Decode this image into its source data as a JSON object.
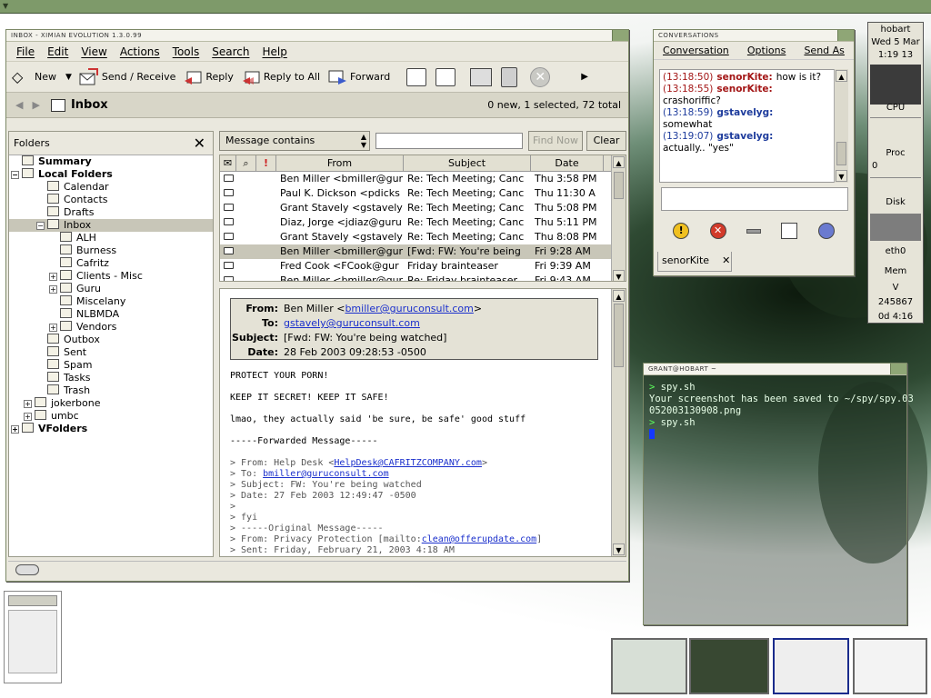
{
  "evolution": {
    "window_title": "INBOX - XIMIAN EVOLUTION 1.3.0.99",
    "menu": [
      "File",
      "Edit",
      "View",
      "Actions",
      "Tools",
      "Search",
      "Help"
    ],
    "toolbar": {
      "new": "New",
      "send_receive": "Send / Receive",
      "reply": "Reply",
      "reply_all": "Reply to All",
      "forward": "Forward"
    },
    "folder_title": "Inbox",
    "folder_count": "0 new, 1 selected, 72 total",
    "folders_header": "Folders",
    "folders": [
      {
        "label": "Summary",
        "depth": 0,
        "bold": true
      },
      {
        "label": "Local Folders",
        "depth": 0,
        "bold": true,
        "expander": "−"
      },
      {
        "label": "Calendar",
        "depth": 2
      },
      {
        "label": "Contacts",
        "depth": 2
      },
      {
        "label": "Drafts",
        "depth": 2
      },
      {
        "label": "Inbox",
        "depth": 2,
        "selected": true,
        "expander": "−"
      },
      {
        "label": "ALH",
        "depth": 3
      },
      {
        "label": "Burness",
        "depth": 3
      },
      {
        "label": "Cafritz",
        "depth": 3
      },
      {
        "label": "Clients - Misc",
        "depth": 3,
        "expander": "+"
      },
      {
        "label": "Guru",
        "depth": 3,
        "expander": "+"
      },
      {
        "label": "Miscelany",
        "depth": 3
      },
      {
        "label": "NLBMDA",
        "depth": 3
      },
      {
        "label": "Vendors",
        "depth": 3,
        "expander": "+"
      },
      {
        "label": "Outbox",
        "depth": 2
      },
      {
        "label": "Sent",
        "depth": 2
      },
      {
        "label": "Spam",
        "depth": 2
      },
      {
        "label": "Tasks",
        "depth": 2
      },
      {
        "label": "Trash",
        "depth": 2
      },
      {
        "label": "jokerbone",
        "depth": 1,
        "expander": "+"
      },
      {
        "label": "umbc",
        "depth": 1,
        "expander": "+"
      },
      {
        "label": "VFolders",
        "depth": 0,
        "bold": true,
        "expander": "+"
      }
    ],
    "search": {
      "option": "Message contains",
      "find_now": "Find Now",
      "clear": "Clear"
    },
    "columns": {
      "flag": "!",
      "from": "From",
      "subject": "Subject",
      "date": "Date"
    },
    "messages": [
      {
        "from": "Ben Miller <bmiller@gur",
        "subject": "Re: Tech Meeting; Canc",
        "date": "Thu 3:58 PM"
      },
      {
        "from": "Paul K. Dickson <pdicks",
        "subject": "Re: Tech Meeting; Canc",
        "date": "Thu 11:30 A"
      },
      {
        "from": "Grant Stavely <gstavely",
        "subject": "Re: Tech Meeting; Canc",
        "date": "Thu 5:08 PM"
      },
      {
        "from": "Diaz, Jorge <jdiaz@guru",
        "subject": "Re: Tech Meeting; Canc",
        "date": "Thu 5:11 PM"
      },
      {
        "from": "Grant Stavely <gstavely",
        "subject": "Re: Tech Meeting; Canc",
        "date": "Thu 8:08 PM"
      },
      {
        "from": "Ben Miller <bmiller@gur",
        "subject": "[Fwd: FW: You're being",
        "date": "Fri 9:28 AM",
        "selected": true
      },
      {
        "from": "Fred Cook <FCook@gur",
        "subject": "Friday brainteaser",
        "date": "Fri 9:39 AM"
      },
      {
        "from": "Ben Miller <bmiller@gur",
        "subject": "Re: Friday brainteaser",
        "date": "Fri 9:43 AM"
      }
    ],
    "preview": {
      "from_label": "From:",
      "from_name": "Ben Miller <",
      "from_email": "bmiller@guruconsult.com",
      "from_end": ">",
      "to_label": "To:",
      "to": "gstavely@guruconsult.com",
      "subject_label": "Subject:",
      "subject": "[Fwd: FW: You're being watched]",
      "date_label": "Date:",
      "date": "28 Feb 2003 09:28:53 -0500",
      "body_1": "PROTECT YOUR PORN!",
      "body_2": "KEEP IT SECRET! KEEP IT SAFE!",
      "body_3": "lmao, they actually said 'be sure, be safe' good stuff",
      "body_4": "-----Forwarded Message-----",
      "q1_pre": "> From: Help Desk <",
      "q1_link": "HelpDesk@CAFRITZCOMPANY.com",
      "q1_post": ">",
      "q2_pre": "> To: ",
      "q2_link": "bmiller@guruconsult.com",
      "q3": "> Subject: FW: You're being watched",
      "q4": "> Date: 27 Feb 2003 12:49:47 -0500",
      "q5": ">",
      "q6": "> fyi",
      "q7": "> -----Original Message-----",
      "q8_pre": "> From: Privacy Protection [mailto:",
      "q8_link": "clean@offerupdate.com",
      "q8_post": "]",
      "q9": "> Sent: Friday, February 21, 2003 4:18 AM"
    }
  },
  "conversations": {
    "window_title": "CONVERSATIONS",
    "menu": [
      "Conversation",
      "Options",
      "Send As"
    ],
    "log": [
      {
        "time": "(13:18:50)",
        "nick": "senorKite:",
        "text": "how is it?",
        "self": false,
        "inline": true
      },
      {
        "time": "(13:18:55)",
        "nick": "senorKite:",
        "text": "crashoriffic?",
        "self": false,
        "inline": false
      },
      {
        "time": "(13:18:59)",
        "nick": "gstavelyg:",
        "text": "somewhat",
        "self": true,
        "inline": false
      },
      {
        "time": "(13:19:07)",
        "nick": "gstavelyg:",
        "text": "actually.. \"yes\"",
        "self": true,
        "inline": false
      }
    ],
    "tab": "senorKite"
  },
  "terminal": {
    "window_title": "GRANT@HOBART ~",
    "line1_prompt": ">",
    "line1_cmd": " spy.sh",
    "line2": "Your screenshot has been saved to ~/spy/spy.03",
    "line3": "052003130908.png",
    "line4_prompt": ">",
    "line4_cmd": " spy.sh"
  },
  "monitor": {
    "host": "hobart",
    "date": "Wed 5 Mar",
    "time": "1:19 13",
    "cpu": "CPU",
    "proc": "Proc",
    "proc_val": "0",
    "disk": "Disk",
    "eth": "eth0",
    "mem": "Mem",
    "v": "V",
    "uptime_num": "245867",
    "uptime": "0d 4:16"
  },
  "colors": {
    "accent": "#7e9a6a",
    "selection": "#c8c6b8",
    "link": "#1a2fcc",
    "chat_other": "#a31616",
    "chat_self": "#1d3b9c"
  }
}
